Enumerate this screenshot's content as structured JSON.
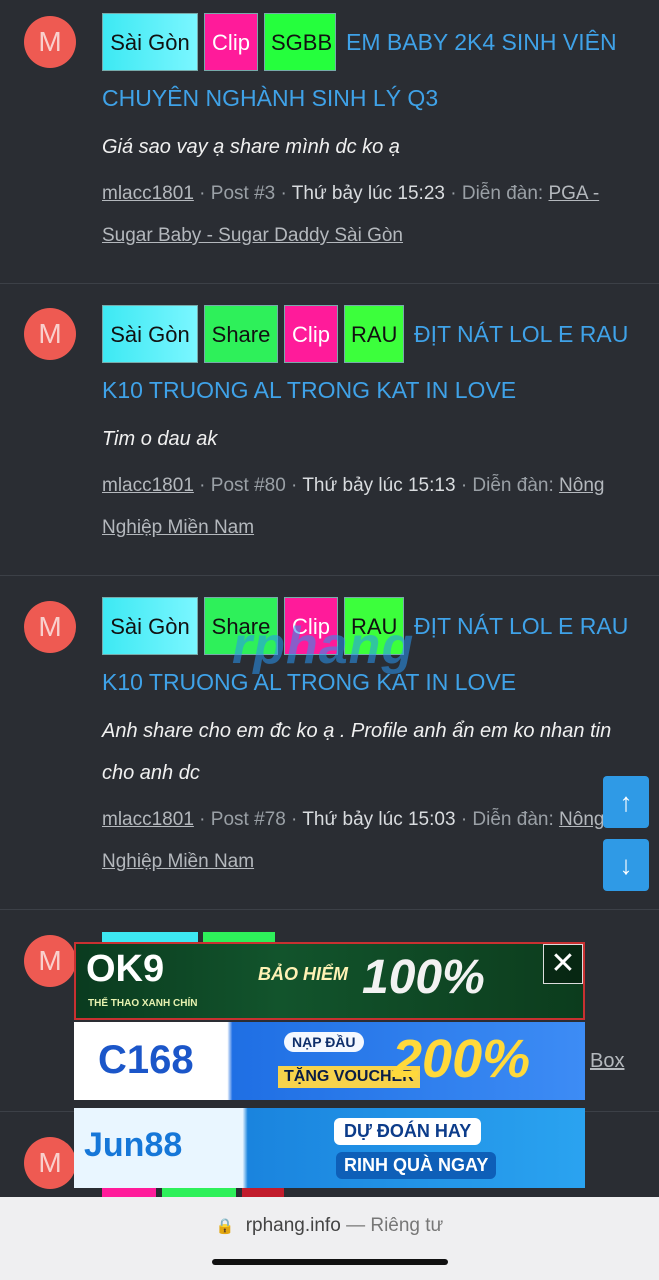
{
  "posts": [
    {
      "avatar_letter": "M",
      "tags": [
        "Sài Gòn",
        "Clip",
        "SGBB"
      ],
      "title_line1": "EM BABY 2K4 SINH VIÊN",
      "title_line2": "CHUYÊN NGHÀNH SINH LÝ Q3",
      "excerpt": "Giá sao vay ạ share mình dc ko ạ",
      "user": "mlacc1801",
      "post_no": "· Post #3 ·",
      "date": "Thứ bảy lúc 15:23",
      "forum_label": "· Diễn đàn:",
      "forum": "PGA - Sugar Baby - Sugar Daddy Sài Gòn"
    },
    {
      "avatar_letter": "M",
      "tags": [
        "Sài Gòn",
        "Share",
        "Clip",
        "RAU"
      ],
      "title_line1": "ĐỊT NÁT LOL E RAU",
      "title_line2": "K10 TRUONG AL TRONG KAT IN LOVE",
      "excerpt": "Tim o dau ak",
      "user": "mlacc1801",
      "post_no": "· Post #80 ·",
      "date": "Thứ bảy lúc 15:13",
      "forum_label": "· Diễn đàn:",
      "forum": "Nông Nghiệp Miền Nam"
    },
    {
      "avatar_letter": "M",
      "tags": [
        "Sài Gòn",
        "Share",
        "Clip",
        "RAU"
      ],
      "title_line1": "ĐỊT NÁT LOL E RAU",
      "title_line2": "K10 TRUONG AL TRONG KAT IN LOVE",
      "excerpt_line1": "Anh share cho em đc ko ạ . Profile anh ẩn em ko nhan tin",
      "excerpt_line2": "cho anh dc",
      "user": "mlacc1801",
      "post_no": "· Post #78 ·",
      "date": "Thứ bảy lúc 15:03",
      "forum_label": "· Diễn đàn:",
      "forum": "Nông Nghiệp Miền Nam"
    },
    {
      "avatar_letter": "M"
    },
    {
      "avatar_letter": "M"
    }
  ],
  "watermark": "rphang",
  "ads": {
    "ok9": {
      "brand": "OK9",
      "tagline": "THỂ THAO XANH CHÍN",
      "slogan": "BẢO HIỂM",
      "big": "100%"
    },
    "c168": {
      "brand": "C168",
      "slogan1": "NẠP ĐẦU",
      "slogan2": "TẶNG VOUCHER",
      "big": "200%"
    },
    "jun88": {
      "brand": "Jun88",
      "slogan1": "DỰ ĐOÁN HAY",
      "slogan2": "RINH QUÀ NGAY"
    },
    "close_glyph": "✕"
  },
  "box_link": "Box",
  "scroll": {
    "up": "↑",
    "down": "↓"
  },
  "browser": {
    "domain": "rphang.info",
    "separator": "—",
    "mode": "Riêng tư",
    "lock": "🔒"
  }
}
